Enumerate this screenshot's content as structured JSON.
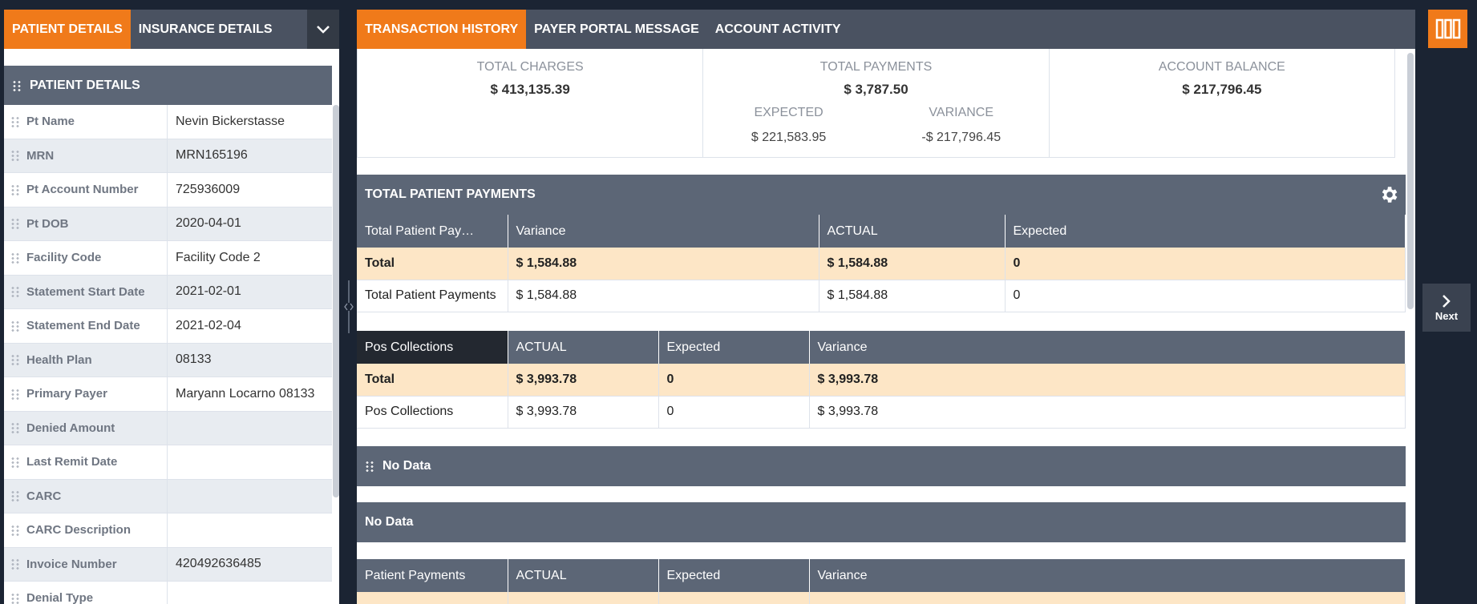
{
  "left_tabs": [
    {
      "label": "PATIENT DETAILS",
      "active": true
    },
    {
      "label": "INSURANCE DETAILS",
      "active": false
    }
  ],
  "patient_section_title": "PATIENT DETAILS",
  "patient_rows": [
    {
      "label": "Pt Name",
      "value": "Nevin Bickerstasse"
    },
    {
      "label": "MRN",
      "value": "MRN165196"
    },
    {
      "label": "Pt Account Number",
      "value": "725936009"
    },
    {
      "label": "Pt DOB",
      "value": "2020-04-01"
    },
    {
      "label": "Facility Code",
      "value": "Facility Code 2"
    },
    {
      "label": "Statement Start Date",
      "value": "2021-02-01"
    },
    {
      "label": "Statement End Date",
      "value": "2021-02-04"
    },
    {
      "label": "Health Plan",
      "value": "08133"
    },
    {
      "label": "Primary Payer",
      "value": "Maryann Locarno 08133"
    },
    {
      "label": "Denied Amount",
      "value": ""
    },
    {
      "label": "Last Remit Date",
      "value": ""
    },
    {
      "label": "CARC",
      "value": ""
    },
    {
      "label": "CARC Description",
      "value": ""
    },
    {
      "label": "Invoice Number",
      "value": "420492636485"
    },
    {
      "label": "Denial Type",
      "value": ""
    }
  ],
  "right_tabs": [
    {
      "label": "TRANSACTION HISTORY",
      "active": true
    },
    {
      "label": "PAYER PORTAL MESSAGE",
      "active": false
    },
    {
      "label": "ACCOUNT ACTIVITY",
      "active": false
    }
  ],
  "summary": {
    "total_charges_label": "TOTAL CHARGES",
    "total_charges": "$ 413,135.39",
    "total_payments_label": "TOTAL PAYMENTS",
    "total_payments": "$ 3,787.50",
    "expected_label": "EXPECTED",
    "expected": "$ 221,583.95",
    "variance_label": "VARIANCE",
    "variance": "-$ 217,796.45",
    "account_balance_label": "ACCOUNT BALANCE",
    "account_balance": "$ 217,796.45"
  },
  "total_patient_payments": {
    "title": "TOTAL PATIENT PAYMENTS",
    "columns": [
      "Total Patient Pay…",
      "Variance",
      "ACTUAL",
      "Expected"
    ],
    "total_row": [
      "Total",
      "$ 1,584.88",
      "$ 1,584.88",
      "0"
    ],
    "rows": [
      [
        "Total Patient Payments",
        "$ 1,584.88",
        "$ 1,584.88",
        "0"
      ]
    ]
  },
  "pos_collections": {
    "columns": [
      "Pos Collections",
      "ACTUAL",
      "Expected",
      "Variance"
    ],
    "total_row": [
      "Total",
      "$ 3,993.78",
      "0",
      "$ 3,993.78"
    ],
    "rows": [
      [
        "Pos Collections",
        "$ 3,993.78",
        "0",
        "$ 3,993.78"
      ]
    ]
  },
  "no_data_1": "No Data",
  "no_data_2": "No Data",
  "patient_payments": {
    "columns": [
      "Patient Payments",
      "ACTUAL",
      "Expected",
      "Variance"
    ]
  },
  "next_label": "Next",
  "colors": {
    "accent": "#f07a1a",
    "header": "#5c6676",
    "total_row": "#fde6c6",
    "background": "#1b2433"
  }
}
